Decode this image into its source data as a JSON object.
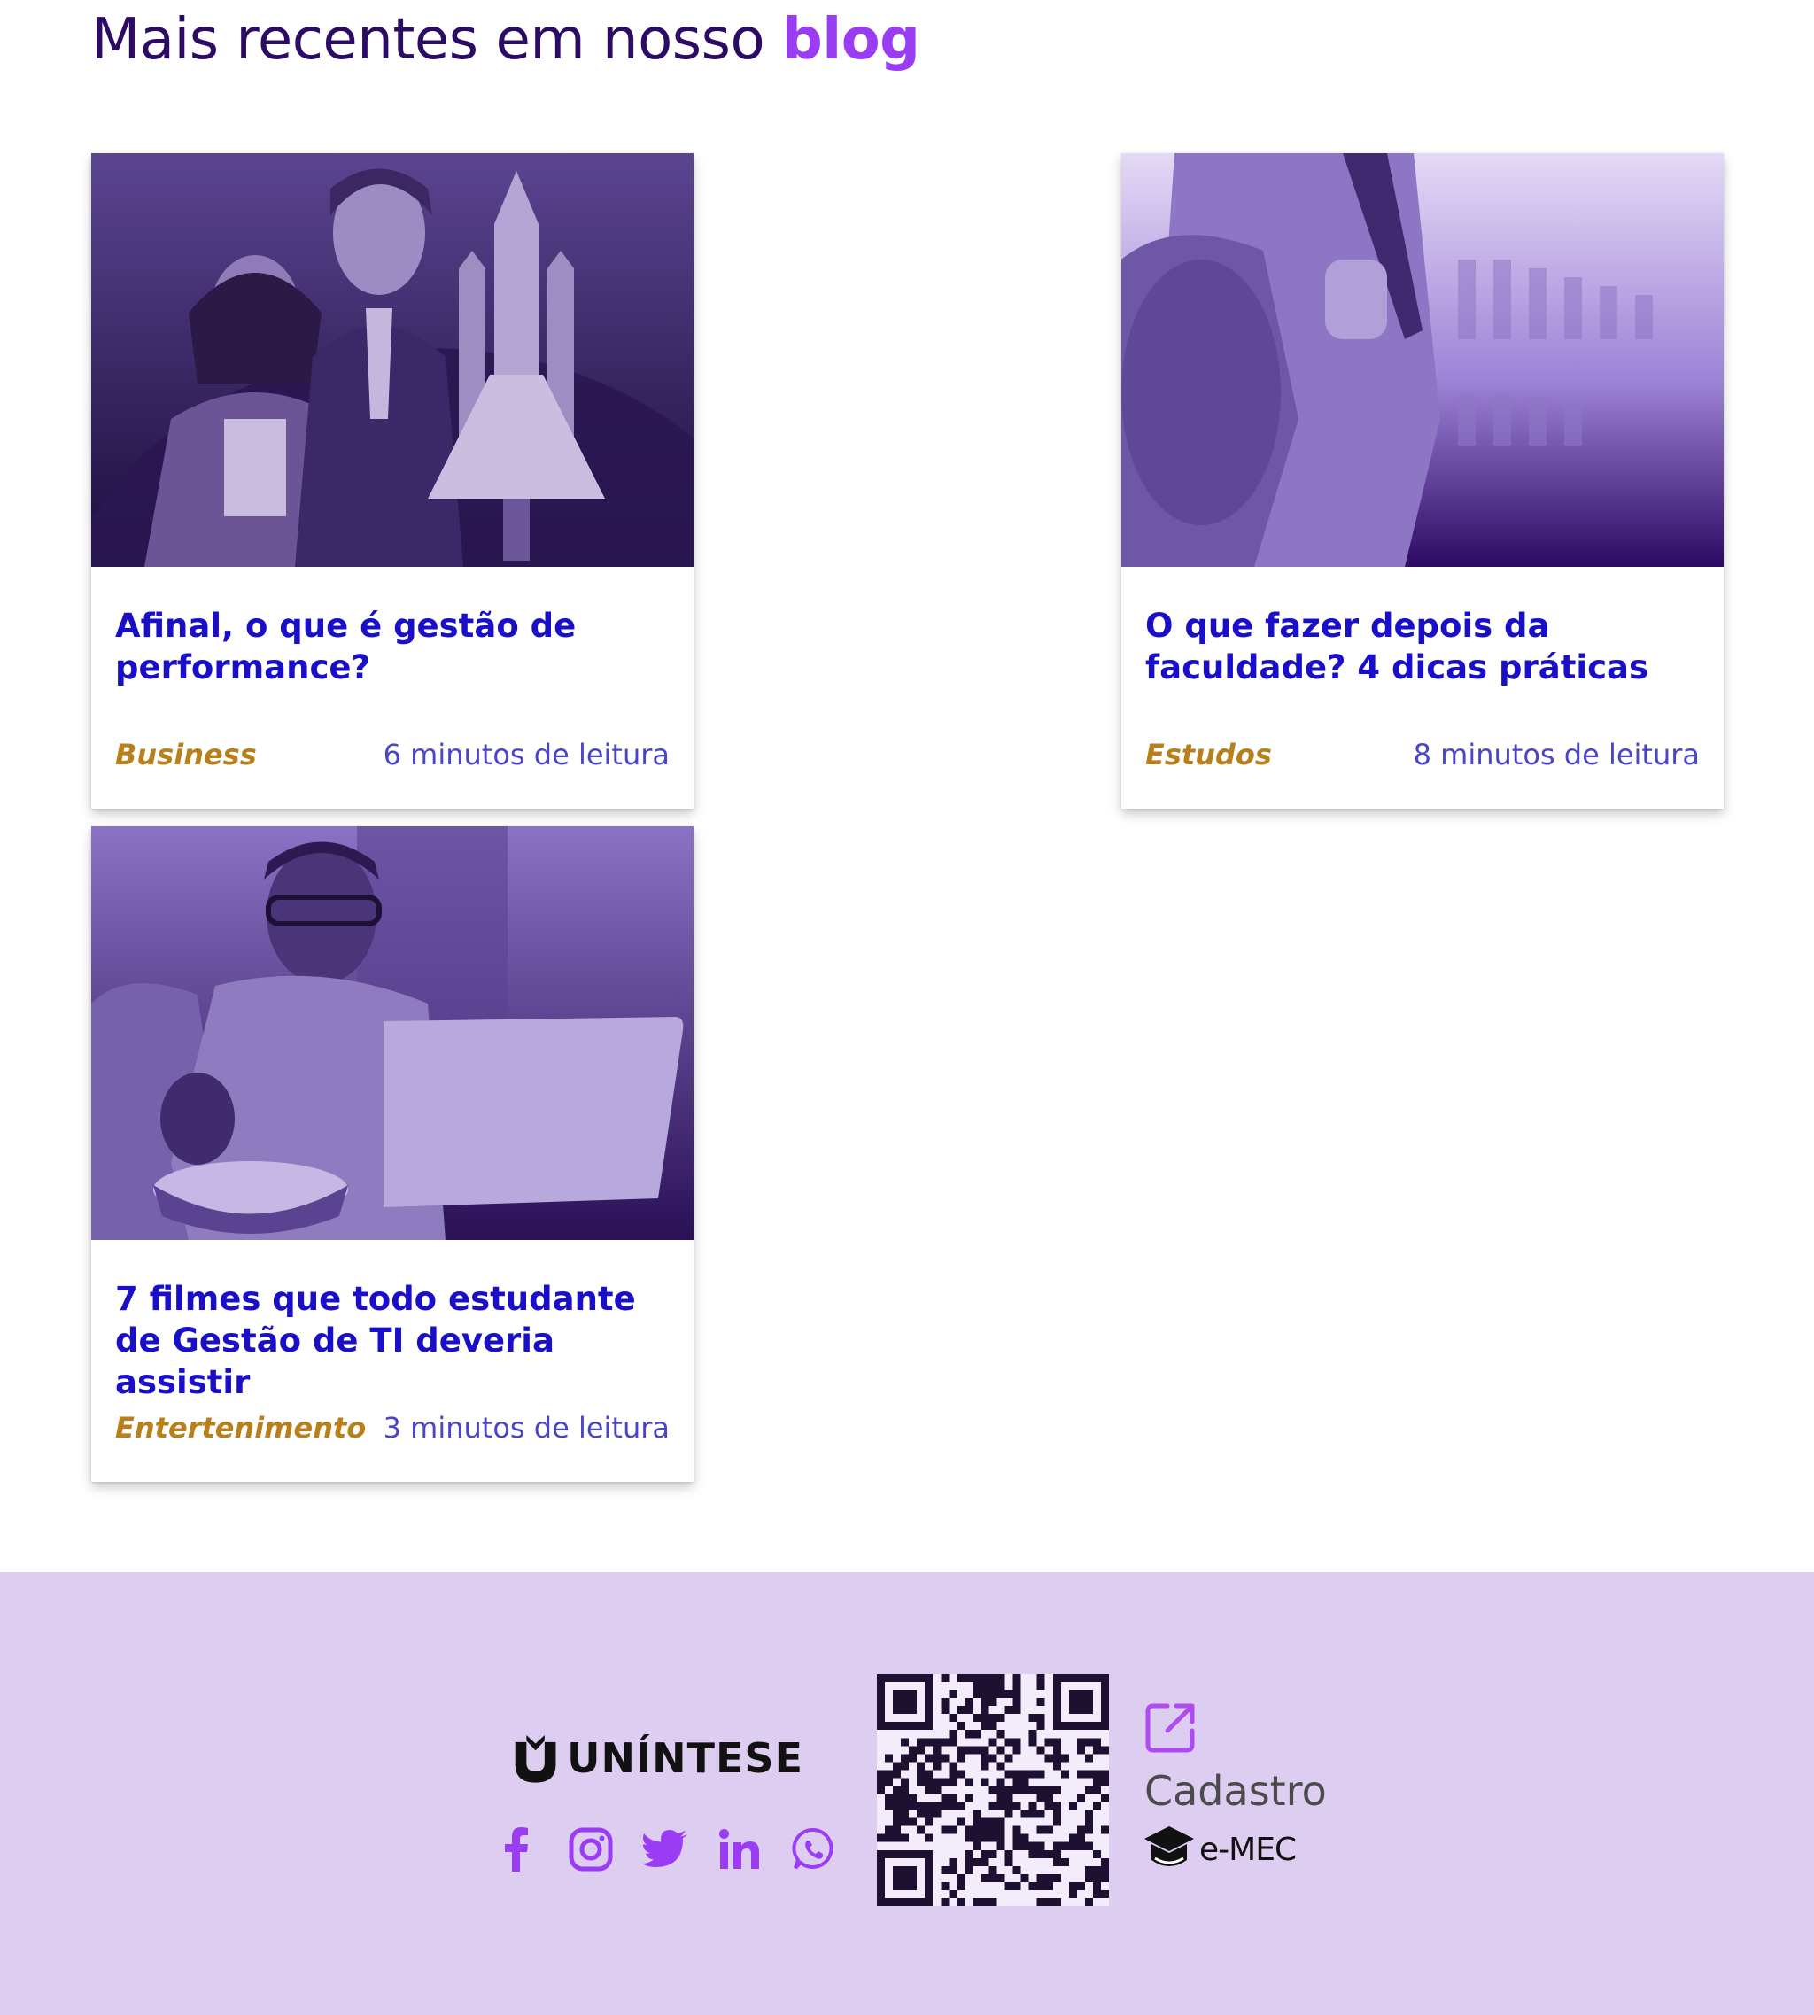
{
  "blog": {
    "heading_prefix": "Mais recentes em nosso",
    "heading_accent": "blog",
    "posts": [
      {
        "title": "Afinal, o que é gestão de performance?",
        "category": "Business",
        "read_time": "6 minutos de leitura",
        "image": "business-people-rocket-photo"
      },
      {
        "title": "O que fazer depois da faculdade? 4 dicas práticas",
        "category": "Estudos",
        "read_time": "8 minutos de leitura",
        "image": "student-backpack-photo"
      },
      {
        "title": "7 filmes que todo estudante de Gestão de TI deveria assistir",
        "category": "Entertenimento",
        "read_time": "3 minutos de leitura",
        "image": "man-laptop-popcorn-photo"
      }
    ]
  },
  "footer": {
    "logo_text": "UNÍNTESE",
    "socials": [
      "facebook-icon",
      "instagram-icon",
      "twitter-icon",
      "linkedin-icon",
      "whatsapp-icon"
    ],
    "qr": "qr-code",
    "emec": {
      "cadastro": "Cadastro",
      "badge": "e-MEC"
    }
  },
  "colors": {
    "heading": "#2b0b63",
    "accent": "#9b3cf5",
    "post_title": "#1a0fc8",
    "category": "#b8801a",
    "read_time": "#4a45c8",
    "footer_bg": "#ddcdf0",
    "social_icon": "#9b3cf5"
  }
}
